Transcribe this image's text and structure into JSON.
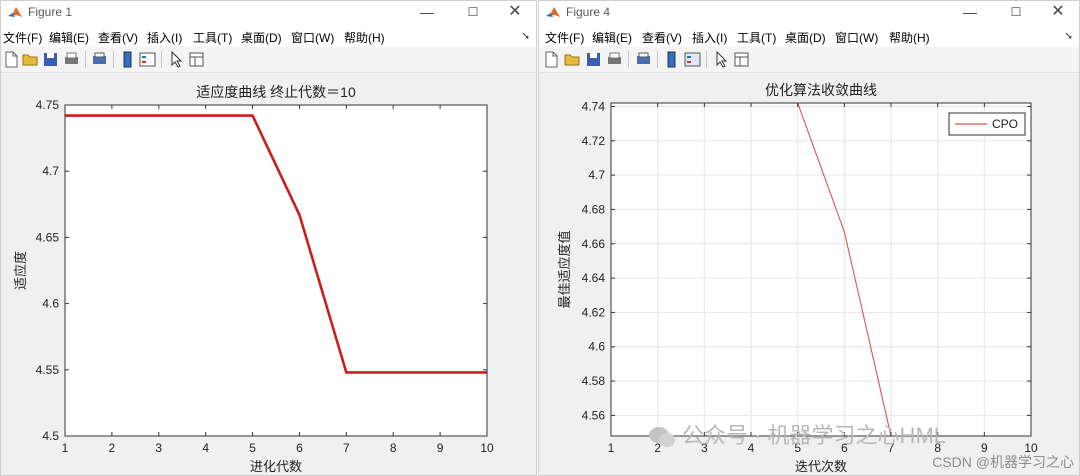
{
  "windows": [
    {
      "title": "Figure 1",
      "menu": [
        "文件(F)",
        "编辑(E)",
        "查看(V)",
        "插入(I)",
        "工具(T)",
        "桌面(D)",
        "窗口(W)",
        "帮助(H)"
      ],
      "controls": {
        "minimize": "—",
        "maximize": "☐",
        "close": "✕"
      }
    },
    {
      "title": "Figure 4",
      "menu": [
        "文件(F)",
        "编辑(E)",
        "查看(V)",
        "插入(I)",
        "工具(T)",
        "桌面(D)",
        "窗口(W)",
        "帮助(H)"
      ],
      "controls": {
        "minimize": "—",
        "maximize": "☐",
        "close": "✕"
      }
    }
  ],
  "toolbar_icons": [
    "new-file-icon",
    "open-folder-icon",
    "save-icon",
    "print-icon",
    "print-preview-icon",
    "colorbar-icon",
    "legend-icon",
    "pointer-icon",
    "property-inspector-icon"
  ],
  "chart_data": [
    {
      "type": "line",
      "title": "适应度曲线  终止代数＝10",
      "xlabel": "进化代数",
      "ylabel": "适应度",
      "x": [
        1,
        2,
        3,
        4,
        5,
        6,
        7,
        8,
        9,
        10
      ],
      "series": [
        {
          "values": [
            4.742,
            4.742,
            4.742,
            4.742,
            4.742,
            4.667,
            4.548,
            4.548,
            4.548,
            4.548
          ],
          "color": "#c81e1e"
        }
      ],
      "xlim": [
        1,
        10
      ],
      "ylim": [
        4.5,
        4.75
      ],
      "xticks": [
        1,
        2,
        3,
        4,
        5,
        6,
        7,
        8,
        9,
        10
      ],
      "yticks": [
        "4.5",
        "4.55",
        "4.6",
        "4.65",
        "4.7",
        "4.75"
      ],
      "grid": false
    },
    {
      "type": "line",
      "title": "优化算法收敛曲线",
      "xlabel": "迭代次数",
      "ylabel": "最佳适应度值",
      "x": [
        1,
        2,
        3,
        4,
        5,
        6,
        7,
        8,
        9,
        10
      ],
      "series": [
        {
          "name": "CPO",
          "values": [
            4.742,
            4.742,
            4.742,
            4.742,
            4.742,
            4.667,
            4.548,
            4.548,
            4.548,
            4.548
          ],
          "color": "#d9534f"
        }
      ],
      "xlim": [
        1,
        10
      ],
      "ylim": [
        4.548,
        4.742
      ],
      "xticks": [
        1,
        2,
        3,
        4,
        5,
        6,
        7,
        8,
        9,
        10
      ],
      "yticks": [
        "4.56",
        "4.58",
        "4.6",
        "4.62",
        "4.64",
        "4.66",
        "4.68",
        "4.7",
        "4.72",
        "4.74"
      ],
      "grid": true,
      "legend": "top-right"
    }
  ],
  "watermark": {
    "text": "公众号 · 机器学习之心HML",
    "credit": "CSDN @机器学习之心"
  }
}
